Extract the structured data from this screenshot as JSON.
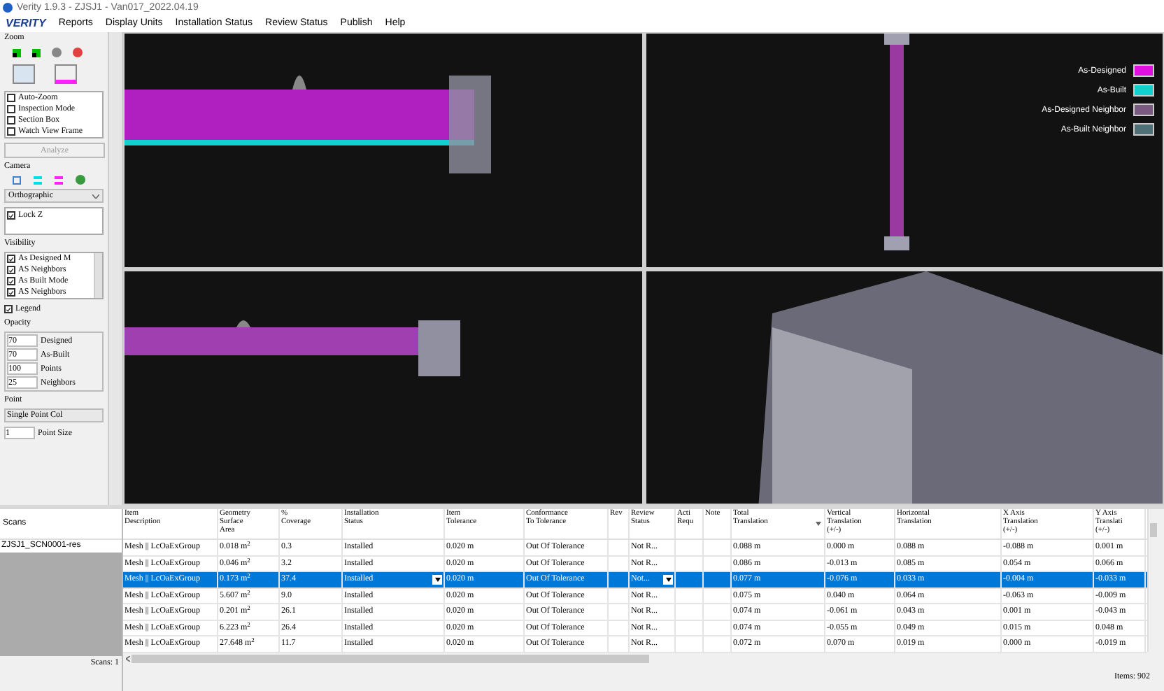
{
  "window": {
    "title": "Verity 1.9.3 - ZJSJ1 - Van017_2022.04.19"
  },
  "menu": {
    "logo": "VERITY",
    "items": [
      "Reports",
      "Display Units",
      "Installation Status",
      "Review Status",
      "Publish",
      "Help"
    ]
  },
  "left_panel": {
    "zoom_title": "Zoom",
    "options": [
      {
        "label": "Auto-Zoom",
        "checked": false
      },
      {
        "label": "Inspection Mode",
        "checked": false
      },
      {
        "label": "Section Box",
        "checked": false
      },
      {
        "label": "Watch View Frame",
        "checked": false
      }
    ],
    "analyze_button": {
      "label": "Analyze",
      "disabled": true
    },
    "camera": {
      "title": "Camera",
      "projection": "Orthographic",
      "lock_z": {
        "label": "Lock Z",
        "checked": true
      }
    },
    "visibility": {
      "title": "Visibility",
      "items": [
        {
          "label": "As Designed M",
          "checked": true
        },
        {
          "label": "AS Neighbors",
          "checked": true
        },
        {
          "label": "As Built Mode",
          "checked": true
        },
        {
          "label": "AS Neighbors",
          "checked": true
        }
      ]
    },
    "legend": {
      "label": "Legend",
      "checked": true
    },
    "opacity": {
      "title": "Opacity",
      "rows": [
        {
          "value": "70",
          "label": "Designed"
        },
        {
          "value": "70",
          "label": "As-Built"
        },
        {
          "value": "100",
          "label": "Points"
        },
        {
          "value": "25",
          "label": "Neighbors"
        }
      ]
    },
    "point": {
      "title": "Point",
      "mode": "Single Point Col",
      "size": {
        "value": "1",
        "label": "Point Size"
      }
    }
  },
  "viewport_legend": [
    {
      "label": "As-Designed",
      "color": "#e010e0"
    },
    {
      "label": "As-Built",
      "color": "#10d0d0"
    },
    {
      "label": "As-Designed Neighbor",
      "color": "#7a5a80"
    },
    {
      "label": "As-Built Neighbor",
      "color": "#507078"
    }
  ],
  "scans": {
    "header": "Scans",
    "items": [
      {
        "label": "ZJSJ1_SCN0001-res",
        "selected": false
      }
    ],
    "footer": "Scans: 1"
  },
  "table": {
    "columns": [
      {
        "label": "Item\nDescription",
        "sorted": false
      },
      {
        "label": "Geometry\nSurface\nArea",
        "sorted": false
      },
      {
        "label": "%\nCoverage",
        "sorted": false
      },
      {
        "label": "Installation\nStatus",
        "sorted": false
      },
      {
        "label": "Item\nTolerance",
        "sorted": false
      },
      {
        "label": "Conformance\nTo Tolerance",
        "sorted": false
      },
      {
        "label": "Rev",
        "sorted": false
      },
      {
        "label": "Review\nStatus",
        "sorted": false
      },
      {
        "label": "Acti\nRequ",
        "sorted": false
      },
      {
        "label": "Note",
        "sorted": false
      },
      {
        "label": "Total\nTranslation",
        "sorted": true
      },
      {
        "label": "Vertical\nTranslation\n(+/-)",
        "sorted": false
      },
      {
        "label": "Horizontal\nTranslation",
        "sorted": false
      },
      {
        "label": "X Axis\nTranslation\n(+/-)",
        "sorted": false
      },
      {
        "label": "Y Axis\nTranslati\n(+/-)",
        "sorted": false
      }
    ],
    "rows": [
      {
        "selected": false,
        "cells": [
          "Mesh || LcOaExGroup",
          "0.018 m$^{2}$",
          "0.3",
          "Installed",
          "0.020 m",
          "Out Of Tolerance",
          "",
          "Not R...",
          "",
          "",
          "0.088 m",
          "0.000 m",
          "0.088 m",
          "-0.088 m",
          "0.001 m"
        ]
      },
      {
        "selected": false,
        "cells": [
          "Mesh || LcOaExGroup",
          "0.046 m$^{2}$",
          "3.2",
          "Installed",
          "0.020 m",
          "Out Of Tolerance",
          "",
          "Not R...",
          "",
          "",
          "0.086 m",
          "-0.013 m",
          "0.085 m",
          "0.054 m",
          "0.066 m"
        ]
      },
      {
        "selected": true,
        "cells": [
          "Mesh || LcOaExGroup",
          "0.173 m$^{2}$",
          "37.4",
          "Installed",
          "0.020 m",
          "Out Of Tolerance",
          "",
          "Not...",
          "",
          "",
          "0.077 m",
          "-0.076 m",
          "0.033 m",
          "-0.004 m",
          "-0.033 m"
        ]
      },
      {
        "selected": false,
        "cells": [
          "Mesh || LcOaExGroup",
          "5.607 m$^{2}$",
          "9.0",
          "Installed",
          "0.020 m",
          "Out Of Tolerance",
          "",
          "Not R...",
          "",
          "",
          "0.075 m",
          "0.040 m",
          "0.064 m",
          "-0.063 m",
          "-0.009 m"
        ]
      },
      {
        "selected": false,
        "cells": [
          "Mesh || LcOaExGroup",
          "0.201 m$^{2}$",
          "26.1",
          "Installed",
          "0.020 m",
          "Out Of Tolerance",
          "",
          "Not R...",
          "",
          "",
          "0.074 m",
          "-0.061 m",
          "0.043 m",
          "0.001 m",
          "-0.043 m"
        ]
      },
      {
        "selected": false,
        "cells": [
          "Mesh || LcOaExGroup",
          "6.223 m$^{2}$",
          "26.4",
          "Installed",
          "0.020 m",
          "Out Of Tolerance",
          "",
          "Not R...",
          "",
          "",
          "0.074 m",
          "-0.055 m",
          "0.049 m",
          "0.015 m",
          "0.048 m"
        ]
      },
      {
        "selected": false,
        "cells": [
          "Mesh || LcOaExGroup",
          "27.648 m$^{2}$",
          "11.7",
          "Installed",
          "0.020 m",
          "Out Of Tolerance",
          "",
          "Not R...",
          "",
          "",
          "0.072 m",
          "0.070 m",
          "0.019 m",
          "0.000 m",
          "-0.019 m"
        ]
      }
    ],
    "footer": "Items: 902"
  }
}
